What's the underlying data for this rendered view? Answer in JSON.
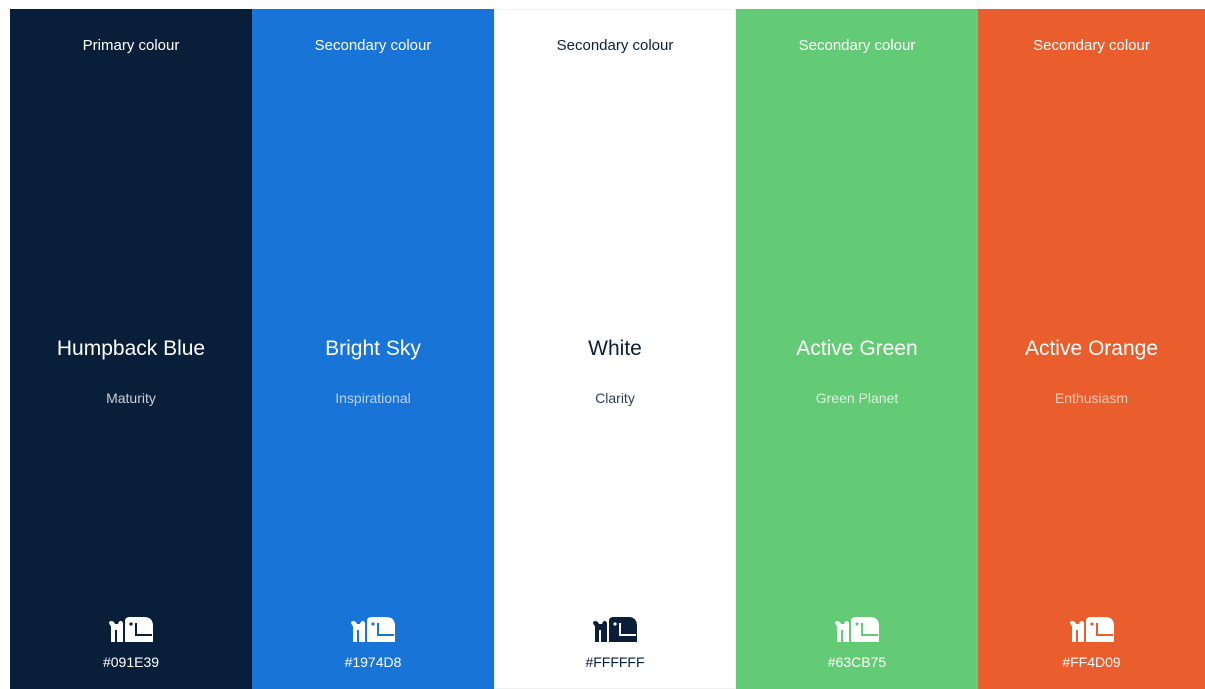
{
  "swatches": [
    {
      "label": "Primary colour",
      "name": "Humpback Blue",
      "trait": "Maturity",
      "hex": "#091E39",
      "background": "#091E39",
      "text_color": "#FFFFFF",
      "trait_color": "#C9CFD8",
      "logo_color": "#FFFFFF",
      "logo_accent": "#091E39",
      "icon": "humpback-logo-icon"
    },
    {
      "label": "Secondary colour",
      "name": "Bright Sky",
      "trait": "Inspirational",
      "hex": "#1974D8",
      "background": "#1974D8",
      "text_color": "#FFFFFF",
      "trait_color": "#B9D4F3",
      "logo_color": "#FFFFFF",
      "logo_accent": "#1974D8",
      "icon": "humpback-logo-icon"
    },
    {
      "label": "Secondary colour",
      "name": "White",
      "trait": "Clarity",
      "hex": "#FFFFFF",
      "background": "#FFFFFF",
      "text_color": "#091E39",
      "trait_color": "#2E3E55",
      "logo_color": "#091E39",
      "logo_accent": "#FFFFFF",
      "icon": "humpback-logo-icon"
    },
    {
      "label": "Secondary colour",
      "name": "Active Green",
      "trait": "Green Planet",
      "hex": "#63CB75",
      "background": "#63CB75",
      "text_color": "#FFFFFF",
      "trait_color": "#D7F2DC",
      "logo_color": "#FFFFFF",
      "logo_accent": "#63CB75",
      "icon": "humpback-logo-icon"
    },
    {
      "label": "Secondary colour",
      "name": "Active Orange",
      "trait": "Enthusiasm",
      "hex": "#FF4D09",
      "background": "#EA5E2E",
      "text_color": "#FFFFFF",
      "trait_color": "#F8C9B4",
      "logo_color": "#FFFFFF",
      "logo_accent": "#EA5E2E",
      "icon": "humpback-logo-icon"
    }
  ]
}
